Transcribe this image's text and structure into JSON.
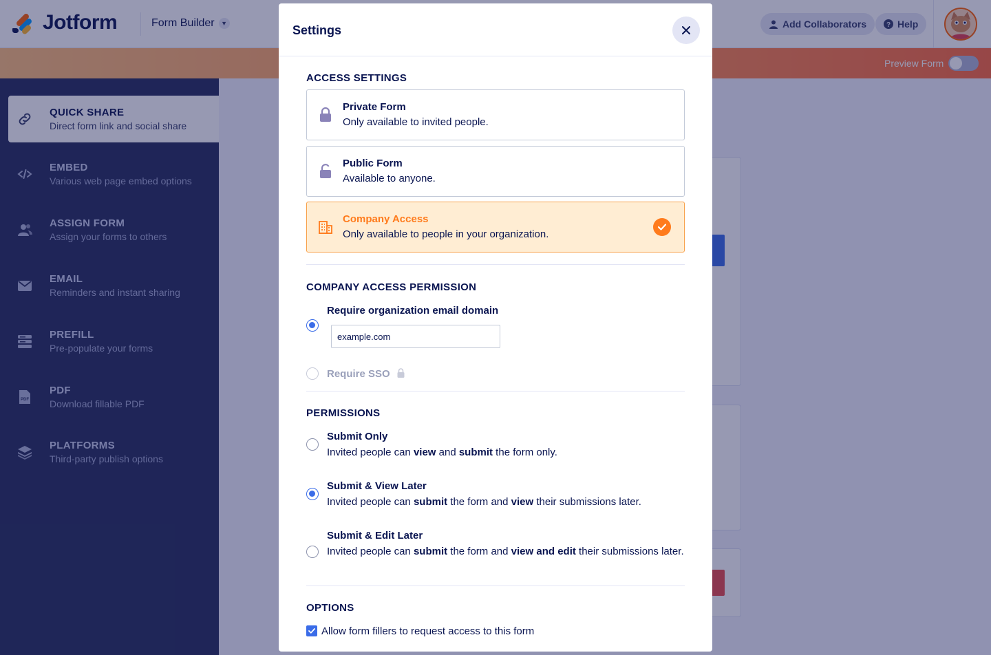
{
  "app": {
    "logo_text": "Jotform",
    "builder_label": "Form Builder",
    "add_collaborators": "Add Collaborators",
    "help": "Help",
    "preview_form": "Preview Form"
  },
  "sidebar": {
    "items": [
      {
        "title": "QUICK SHARE",
        "subtitle": "Direct form link and social share",
        "icon": "link-icon"
      },
      {
        "title": "EMBED",
        "subtitle": "Various web page embed options",
        "icon": "code-icon"
      },
      {
        "title": "ASSIGN FORM",
        "subtitle": "Assign your forms to others",
        "icon": "users-icon"
      },
      {
        "title": "EMAIL",
        "subtitle": "Reminders and instant sharing",
        "icon": "envelope-icon"
      },
      {
        "title": "PREFILL",
        "subtitle": "Pre-populate your forms",
        "icon": "prefill-icon"
      },
      {
        "title": "PDF",
        "subtitle": "Download fillable PDF",
        "icon": "pdf-icon"
      },
      {
        "title": "PLATFORMS",
        "subtitle": "Third-party publish options",
        "icon": "layers-icon"
      }
    ]
  },
  "modal": {
    "title": "Settings",
    "access_settings": {
      "heading": "ACCESS SETTINGS",
      "options": [
        {
          "title": "Private Form",
          "desc": "Only available to invited people.",
          "icon": "lock-icon",
          "selected": false
        },
        {
          "title": "Public Form",
          "desc": "Available to anyone.",
          "icon": "unlock-icon",
          "selected": false
        },
        {
          "title": "Company Access",
          "desc": "Only available to people in your organization.",
          "icon": "building-icon",
          "selected": true
        }
      ]
    },
    "company_access": {
      "heading": "COMPANY ACCESS PERMISSION",
      "require_domain_label": "Require organization email domain",
      "domain_value": "example.com",
      "require_sso_label": "Require SSO"
    },
    "permissions": {
      "heading": "PERMISSIONS",
      "submit_only": {
        "title": "Submit Only",
        "p1": "Invited people can ",
        "b1": "view",
        "p2": " and ",
        "b2": "submit",
        "p3": " the form only."
      },
      "submit_view": {
        "title": "Submit & View Later",
        "p1": "Invited people can ",
        "b1": "submit",
        "p2": " the form and ",
        "b2": "view",
        "p3": " their submissions later."
      },
      "submit_edit": {
        "title": "Submit & Edit Later",
        "p1": "Invited people can ",
        "b1": "submit",
        "p2": " the form and ",
        "b2": "view and edit",
        "p3": " their submissions later."
      }
    },
    "options": {
      "heading": "OPTIONS",
      "allow_request_label": "Allow form fillers to request access to this form"
    }
  },
  "colors": {
    "navy": "#0a1551",
    "sidebar_bg": "#252d5b",
    "accent_blue": "#3a6ce8",
    "accent_orange": "#ff7b1c",
    "selected_bg": "#ffedd3"
  }
}
